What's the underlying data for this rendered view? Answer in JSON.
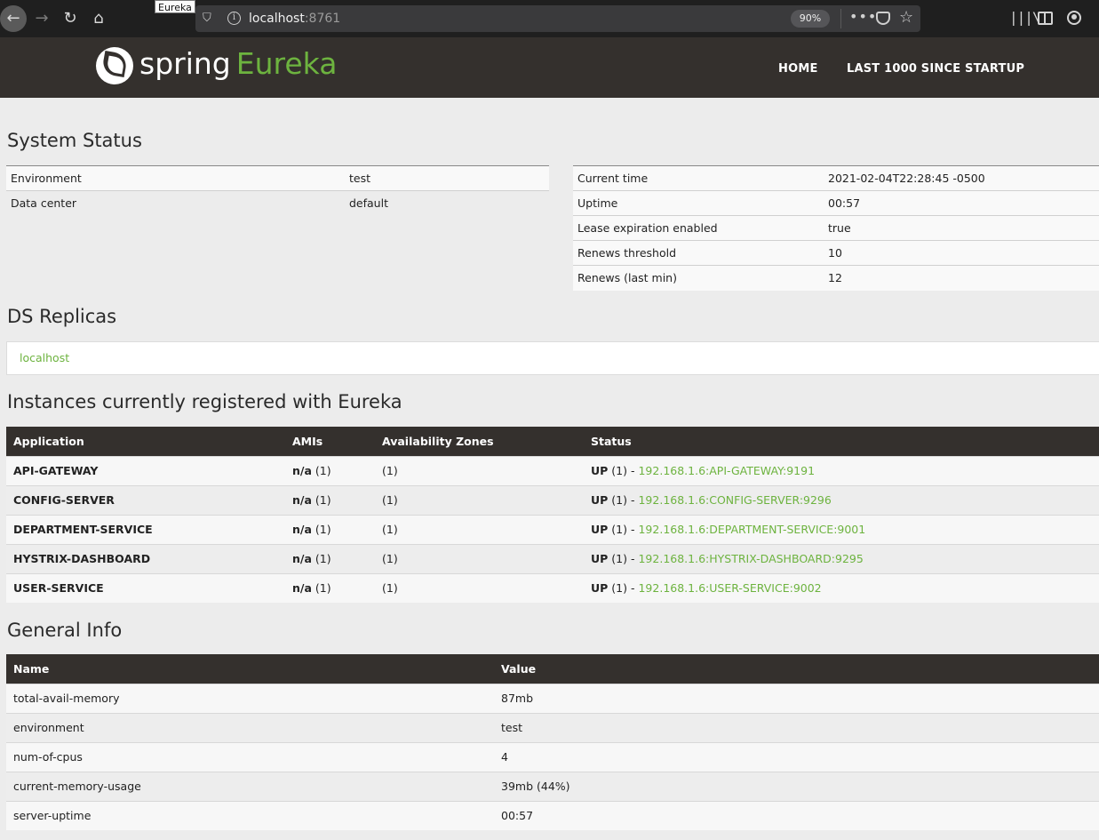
{
  "browser": {
    "tab_tooltip": "Eureka",
    "url_host": "localhost",
    "url_port": ":8761",
    "zoom": "90%"
  },
  "navbar": {
    "logo_spring": "spring",
    "logo_eureka": "Eureka",
    "links": [
      "HOME",
      "LAST 1000 SINCE STARTUP"
    ]
  },
  "system_status": {
    "title": "System Status",
    "left": [
      {
        "label": "Environment",
        "value": "test"
      },
      {
        "label": "Data center",
        "value": "default"
      }
    ],
    "right": [
      {
        "label": "Current time",
        "value": "2021-02-04T22:28:45 -0500"
      },
      {
        "label": "Uptime",
        "value": "00:57"
      },
      {
        "label": "Lease expiration enabled",
        "value": "true"
      },
      {
        "label": "Renews threshold",
        "value": "10"
      },
      {
        "label": "Renews (last min)",
        "value": "12"
      }
    ]
  },
  "replicas": {
    "title": "DS Replicas",
    "items": [
      "localhost"
    ]
  },
  "instances": {
    "title": "Instances currently registered with Eureka",
    "headers": [
      "Application",
      "AMIs",
      "Availability Zones",
      "Status"
    ],
    "rows": [
      {
        "app": "API-GATEWAY",
        "ami": "n/a",
        "ami_count": "(1)",
        "zones": "(1)",
        "status": "UP",
        "status_count": "(1) -",
        "link": "192.168.1.6:API-GATEWAY:9191"
      },
      {
        "app": "CONFIG-SERVER",
        "ami": "n/a",
        "ami_count": "(1)",
        "zones": "(1)",
        "status": "UP",
        "status_count": "(1) -",
        "link": "192.168.1.6:CONFIG-SERVER:9296"
      },
      {
        "app": "DEPARTMENT-SERVICE",
        "ami": "n/a",
        "ami_count": "(1)",
        "zones": "(1)",
        "status": "UP",
        "status_count": "(1) -",
        "link": "192.168.1.6:DEPARTMENT-SERVICE:9001"
      },
      {
        "app": "HYSTRIX-DASHBOARD",
        "ami": "n/a",
        "ami_count": "(1)",
        "zones": "(1)",
        "status": "UP",
        "status_count": "(1) -",
        "link": "192.168.1.6:HYSTRIX-DASHBOARD:9295"
      },
      {
        "app": "USER-SERVICE",
        "ami": "n/a",
        "ami_count": "(1)",
        "zones": "(1)",
        "status": "UP",
        "status_count": "(1) -",
        "link": "192.168.1.6:USER-SERVICE:9002"
      }
    ]
  },
  "general_info": {
    "title": "General Info",
    "headers": [
      "Name",
      "Value"
    ],
    "rows": [
      {
        "name": "total-avail-memory",
        "value": "87mb"
      },
      {
        "name": "environment",
        "value": "test"
      },
      {
        "name": "num-of-cpus",
        "value": "4"
      },
      {
        "name": "current-memory-usage",
        "value": "39mb (44%)"
      },
      {
        "name": "server-uptime",
        "value": "00:57"
      }
    ]
  }
}
